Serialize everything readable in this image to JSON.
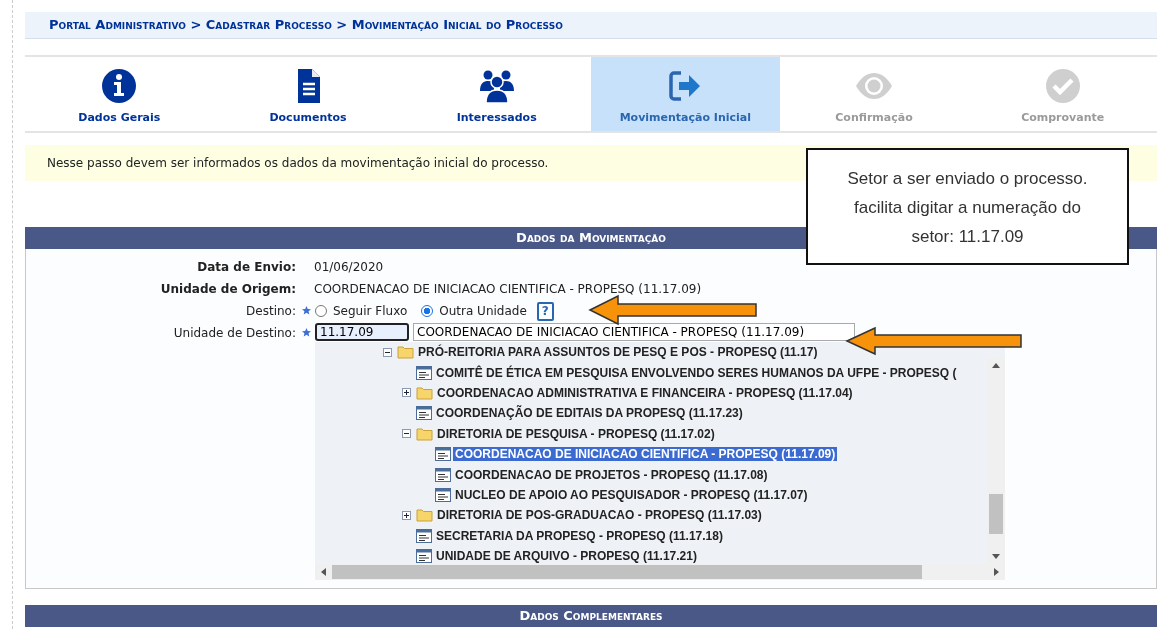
{
  "breadcrumb": "Portal Administrativo > Cadastrar Processo > Movimentação Inicial do Processo",
  "steps": [
    {
      "label": "Dados Gerais",
      "selected": false,
      "disabled": false
    },
    {
      "label": "Documentos",
      "selected": false,
      "disabled": false
    },
    {
      "label": "Interessados",
      "selected": false,
      "disabled": false
    },
    {
      "label": "Movimentação Inicial",
      "selected": true,
      "disabled": false
    },
    {
      "label": "Confirmação",
      "selected": false,
      "disabled": true
    },
    {
      "label": "Comprovante",
      "selected": false,
      "disabled": true
    }
  ],
  "message": "Nesse passo devem ser informados os dados da movimentação inicial do processo.",
  "callout": "Setor a ser enviado o processo. facilita digitar a numeração do setor: 11.17.09",
  "movimentacao": {
    "title": "Dados da Movimentação",
    "data_envio": {
      "label": "Data de Envio:",
      "value": "01/06/2020"
    },
    "unidade_origem": {
      "label": "Unidade de Origem:",
      "value": "COORDENACAO DE INICIACAO CIENTIFICA - PROPESQ (11.17.09)"
    },
    "destino": {
      "label": "Destino:",
      "required": true,
      "options": [
        {
          "label": "Seguir Fluxo",
          "selected": false
        },
        {
          "label": "Outra Unidade",
          "selected": true
        }
      ],
      "help": "?"
    },
    "unidade_destino": {
      "label": "Unidade de Destino:",
      "required": true,
      "code": "11.17.09",
      "name": "COORDENACAO DE INICIACAO CIENTIFICA - PROPESQ (11.17.09)"
    },
    "tree": [
      {
        "label": "PRÓ-REITORIA PARA ASSUNTOS DE PESQ E POS - PROPESQ (11.17)",
        "kind": "folder",
        "expanded": true,
        "selected": false,
        "children": [
          {
            "label": "COMITÊ DE ÉTICA EM PESQUISA ENVOLVENDO SERES HUMANOS DA UFPE - PROPESQ (",
            "kind": "unit",
            "selected": false
          },
          {
            "label": "COORDENACAO ADMINISTRATIVA E FINANCEIRA - PROPESQ (11.17.04)",
            "kind": "folder",
            "expanded": false,
            "selected": false
          },
          {
            "label": "COORDENAÇÃO DE EDITAIS DA PROPESQ (11.17.23)",
            "kind": "unit",
            "selected": false
          },
          {
            "label": "DIRETORIA DE PESQUISA - PROPESQ (11.17.02)",
            "kind": "folder",
            "expanded": true,
            "selected": false,
            "children": [
              {
                "label": "COORDENACAO DE INICIACAO CIENTIFICA - PROPESQ (11.17.09)",
                "kind": "unit",
                "selected": true
              },
              {
                "label": "COORDENACAO DE PROJETOS - PROPESQ (11.17.08)",
                "kind": "unit",
                "selected": false
              },
              {
                "label": "NUCLEO DE APOIO AO PESQUISADOR - PROPESQ (11.17.07)",
                "kind": "unit",
                "selected": false
              }
            ]
          },
          {
            "label": "DIRETORIA DE POS-GRADUACAO - PROPESQ (11.17.03)",
            "kind": "folder",
            "expanded": false,
            "selected": false
          },
          {
            "label": "SECRETARIA DA PROPESQ - PROPESQ (11.17.18)",
            "kind": "unit",
            "selected": false
          },
          {
            "label": "UNIDADE DE ARQUIVO - PROPESQ (11.17.21)",
            "kind": "unit",
            "selected": false
          }
        ]
      }
    ]
  },
  "complementares": {
    "title": "Dados Complementares"
  }
}
